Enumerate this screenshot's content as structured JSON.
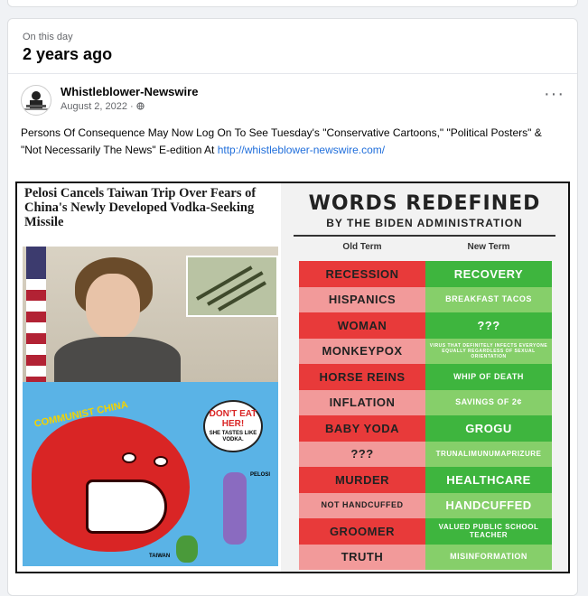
{
  "memory": {
    "label": "On this day",
    "title": "2 years ago"
  },
  "post": {
    "author": "Whistleblower-Newswire",
    "date": "August 2, 2022 ·",
    "privacy_icon": "globe-icon",
    "more_label": "···",
    "text": "Persons Of Consequence May Now Log On To See Tuesday's \"Conservative Cartoons,\" \"Political Posters\" & \"Not Necessarily The News\" E-edition At ",
    "link": "http://whistleblower-newswire.com/"
  },
  "image": {
    "headline": "Pelosi Cancels Taiwan Trip Over Fears of China's Newly Developed Vodka-Seeking Missile",
    "cartoon": {
      "banner": "COMMUNIST CHINA",
      "bubble_big": "DON'T EAT HER!",
      "bubble_small": "SHE TASTES LIKE VODKA.",
      "name_pelosi": "PELOSI",
      "name_taiwan": "TAIWAN"
    },
    "poster": {
      "title": "WORDS REDEFINED",
      "subtitle": "BY THE BIDEN ADMINISTRATION",
      "old_header": "Old Term",
      "new_header": "New Term",
      "rows": [
        {
          "old": "RECESSION",
          "new": "RECOVERY"
        },
        {
          "old": "HISPANICS",
          "new": "BREAKFAST TACOS"
        },
        {
          "old": "WOMAN",
          "new": "???"
        },
        {
          "old": "MONKEYPOX",
          "new": "VIRUS THAT DEFINITELY INFECTS EVERYONE EQUALLY REGARDLESS OF SEXUAL ORIENTATION"
        },
        {
          "old": "HORSE REINS",
          "new": "WHIP OF DEATH"
        },
        {
          "old": "INFLATION",
          "new": "SAVINGS OF 2¢"
        },
        {
          "old": "BABY YODA",
          "new": "GROGU"
        },
        {
          "old": "???",
          "new": "TRUNALIMUNUMAPRIZURE"
        },
        {
          "old": "MURDER",
          "new": "HEALTHCARE"
        },
        {
          "old": "NOT HANDCUFFED",
          "new": "HANDCUFFED"
        },
        {
          "old": "GROOMER",
          "new": "VALUED PUBLIC SCHOOL TEACHER"
        },
        {
          "old": "TRUTH",
          "new": "MISINFORMATION"
        }
      ]
    }
  },
  "colors": {
    "link": "#216fdb",
    "red": "#e83a3a",
    "green": "#3eb53e"
  }
}
